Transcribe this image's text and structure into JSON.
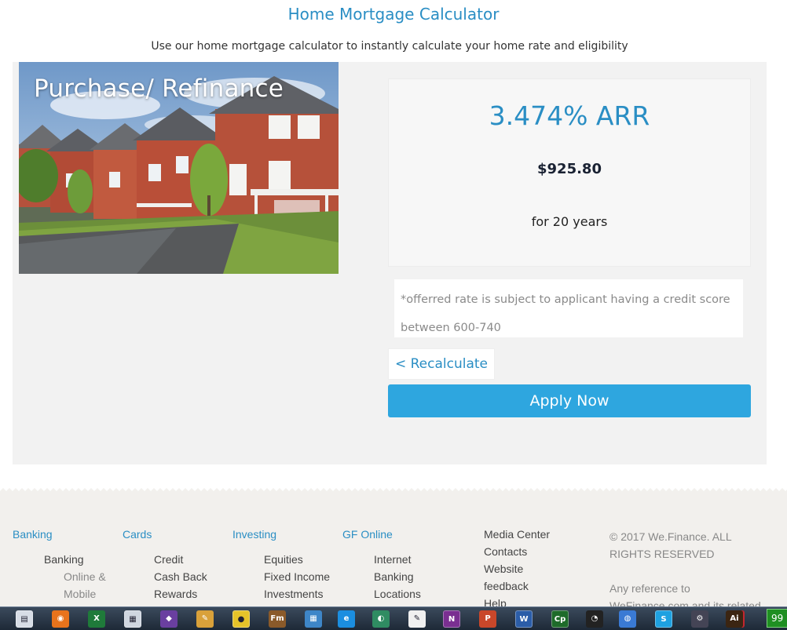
{
  "header": {
    "title": "Home Mortgage Calculator",
    "subtitle": "Use our home mortgage calculator to instantly calculate your home rate and eligibility"
  },
  "hero": {
    "caption": "Purchase/ Refinance"
  },
  "result": {
    "rate": "3.474% ARR",
    "payment": "$925.80",
    "term": "for 20 years"
  },
  "disclaimer": "*offerred rate is subject to applicant having a credit score between 600-740",
  "actions": {
    "recalculate": "< Recalculate",
    "apply": "Apply Now"
  },
  "footer": {
    "banking": {
      "heading": "Banking",
      "item1": "Banking",
      "item2a": "Online &",
      "item2b": "Mobile"
    },
    "cards": {
      "heading": "Cards",
      "item1": "Credit",
      "item2": "Cash Back",
      "item3": "Rewards"
    },
    "investing": {
      "heading": "Investing",
      "item1": "Equities",
      "item2": "Fixed Income",
      "item3": "Investments"
    },
    "gf_online": {
      "heading": "GF Online",
      "item1": "Internet",
      "item2": "Banking",
      "item3": "Locations"
    },
    "misc": {
      "item1": "Media Center",
      "item2": "Contacts",
      "item3": "Website",
      "item4": "feedback",
      "item5": "Help"
    },
    "legal": {
      "copyright": "© 2017 We.Finance. ALL RIGHTS RESERVED",
      "notice": "Any reference to WeFinance.com and its related logo is for Adobe"
    }
  },
  "taskbar": {
    "apps": [
      "explorer-icon",
      "firefox-icon",
      "excel-icon",
      "calculator-icon",
      "visual-studio-icon",
      "paint-icon",
      "chrome-icon",
      "framemaker-icon",
      "control-panel-icon",
      "internet-explorer-icon",
      "browser-icon",
      "notepad-icon",
      "onenote-icon",
      "powerpoint-icon",
      "word-icon",
      "captivate-icon",
      "media-icon",
      "network-icon",
      "skype-icon",
      "tool-icon",
      "creative-cloud-icon",
      "illustrator-icon"
    ],
    "tray_text": "99"
  },
  "colors": {
    "accent": "#2a8ec4",
    "button": "#2ea6df",
    "panel": "#f2f2f2",
    "footer": "#f2f0ed"
  }
}
